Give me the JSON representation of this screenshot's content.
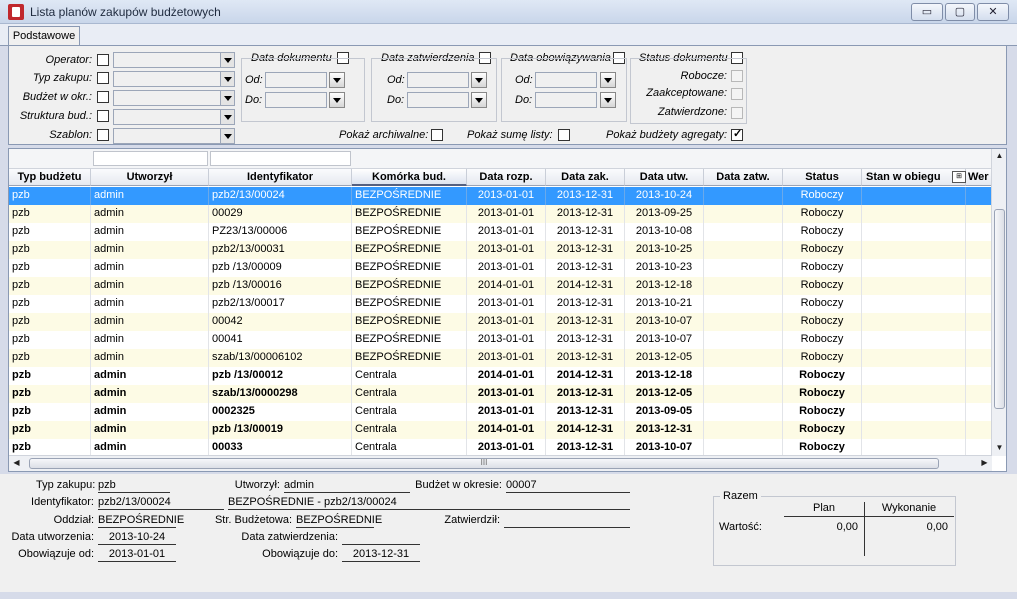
{
  "window": {
    "title": "Lista planów zakupów budżetowych",
    "minimize": "▭",
    "maximize": "▢",
    "close": "✕"
  },
  "tabs": [
    "Podstawowe"
  ],
  "filters": {
    "operator": "Operator:",
    "typ_zakupu": "Typ zakupu:",
    "budzet_w_okr": "Budżet w okr.:",
    "struktura_bud": "Struktura bud.:",
    "szablon": "Szablon:",
    "data_dokumentu": "Data dokumentu",
    "data_zatwierdzenia": "Data zatwierdzenia",
    "data_obowiazywania": "Data obowiązywania",
    "od": "Od:",
    "do": "Do:",
    "status_dokumentu": "Status dokumentu",
    "robocze": "Robocze:",
    "zaakceptowane": "Zaakceptowane:",
    "zatwierdzone": "Zatwierdzone:",
    "pokaz_archiwalne": "Pokaż archiwalne:",
    "pokaz_sume": "Pokaż sumę listy:",
    "pokaz_agregaty": "Pokaż budżety agregaty:"
  },
  "grid": {
    "columns": [
      "Typ budżetu",
      "Utworzył",
      "Identyfikator",
      "Komórka bud.",
      "Data rozp.",
      "Data zak.",
      "Data utw.",
      "Data zatw.",
      "Status",
      "Stan w obiegu",
      "Wer"
    ],
    "rows": [
      [
        "pzb",
        "admin",
        "pzb2/13/00024",
        "BEZPOŚREDNIE",
        "2013-01-01",
        "2013-12-31",
        "2013-10-24",
        "",
        "Roboczy",
        ""
      ],
      [
        "pzb",
        "admin",
        "00029",
        "BEZPOŚREDNIE",
        "2013-01-01",
        "2013-12-31",
        "2013-09-25",
        "",
        "Roboczy",
        ""
      ],
      [
        "pzb",
        "admin",
        "PZ23/13/00006",
        "BEZPOŚREDNIE",
        "2013-01-01",
        "2013-12-31",
        "2013-10-08",
        "",
        "Roboczy",
        ""
      ],
      [
        "pzb",
        "admin",
        "pzb2/13/00031",
        "BEZPOŚREDNIE",
        "2013-01-01",
        "2013-12-31",
        "2013-10-25",
        "",
        "Roboczy",
        ""
      ],
      [
        "pzb",
        "admin",
        "pzb /13/00009",
        "BEZPOŚREDNIE",
        "2013-01-01",
        "2013-12-31",
        "2013-10-23",
        "",
        "Roboczy",
        ""
      ],
      [
        "pzb",
        "admin",
        "pzb /13/00016",
        "BEZPOŚREDNIE",
        "2014-01-01",
        "2014-12-31",
        "2013-12-18",
        "",
        "Roboczy",
        ""
      ],
      [
        "pzb",
        "admin",
        "pzb2/13/00017",
        "BEZPOŚREDNIE",
        "2013-01-01",
        "2013-12-31",
        "2013-10-21",
        "",
        "Roboczy",
        ""
      ],
      [
        "pzb",
        "admin",
        "00042",
        "BEZPOŚREDNIE",
        "2013-01-01",
        "2013-12-31",
        "2013-10-07",
        "",
        "Roboczy",
        ""
      ],
      [
        "pzb",
        "admin",
        "00041",
        "BEZPOŚREDNIE",
        "2013-01-01",
        "2013-12-31",
        "2013-10-07",
        "",
        "Roboczy",
        ""
      ],
      [
        "pzb",
        "admin",
        "szab/13/00006102",
        "BEZPOŚREDNIE",
        "2013-01-01",
        "2013-12-31",
        "2013-12-05",
        "",
        "Roboczy",
        ""
      ],
      [
        "pzb",
        "admin",
        "pzb /13/00012",
        "Centrala",
        "2014-01-01",
        "2014-12-31",
        "2013-12-18",
        "",
        "Roboczy",
        ""
      ],
      [
        "pzb",
        "admin",
        "szab/13/0000298",
        "Centrala",
        "2013-01-01",
        "2013-12-31",
        "2013-12-05",
        "",
        "Roboczy",
        ""
      ],
      [
        "pzb",
        "admin",
        "0002325",
        "Centrala",
        "2013-01-01",
        "2013-12-31",
        "2013-09-05",
        "",
        "Roboczy",
        ""
      ],
      [
        "pzb",
        "admin",
        "pzb /13/00019",
        "Centrala",
        "2014-01-01",
        "2014-12-31",
        "2013-12-31",
        "",
        "Roboczy",
        ""
      ],
      [
        "pzb",
        "admin",
        "00033",
        "Centrala",
        "2013-01-01",
        "2013-12-31",
        "2013-10-07",
        "",
        "Roboczy",
        ""
      ]
    ],
    "hscroll_grip": "III"
  },
  "details": {
    "typ_zakupu_label": "Typ zakupu:",
    "typ_zakupu": "pzb",
    "utworzyl_label": "Utworzył:",
    "utworzyl": "admin",
    "budzet_label": "Budżet w okresie:",
    "budzet": "00007",
    "identyfikator_label": "Identyfikator:",
    "identyfikator": "pzb2/13/00024",
    "identyfikator_pelny": "BEZPOŚREDNIE - pzb2/13/00024",
    "oddzial_label": "Oddział:",
    "oddzial": "BEZPOŚREDNIE",
    "str_budzetowa_label": "Str. Budżetowa:",
    "str_budzetowa": "BEZPOŚREDNIE",
    "zatwierdzil_label": "Zatwierdził:",
    "zatwierdzil": "",
    "data_utworzenia_label": "Data utworzenia:",
    "data_utworzenia": "2013-10-24",
    "data_zatwierdzenia_label": "Data zatwierdzenia:",
    "data_zatwierdzenia": "",
    "obowiazuje_od_label": "Obowiązuje od:",
    "obowiazuje_od": "2013-01-01",
    "obowiazuje_do_label": "Obowiązuje do:",
    "obowiazuje_do": "2013-12-31"
  },
  "razem": {
    "title": "Razem",
    "plan": "Plan",
    "wykonanie": "Wykonanie",
    "wartosc_label": "Wartość:",
    "plan_value": "0,00",
    "wykonanie_value": "0,00"
  }
}
